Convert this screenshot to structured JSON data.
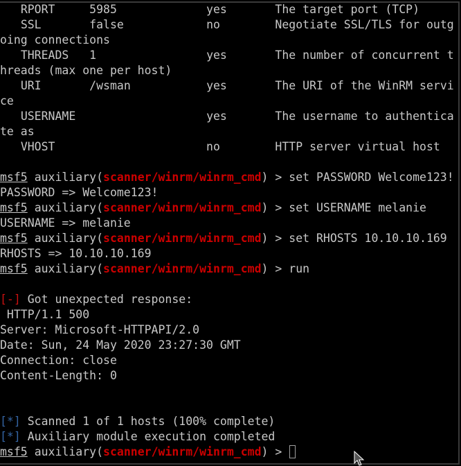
{
  "options_table": {
    "rows": [
      {
        "name": "RPORT",
        "setting": "5985",
        "required": "yes",
        "description": "The target port (TCP)",
        "wrap": null
      },
      {
        "name": "SSL",
        "setting": "false",
        "required": "no",
        "description": "Negotiate SSL/TLS for outg",
        "wrap": "oing connections"
      },
      {
        "name": "THREADS",
        "setting": "1",
        "required": "yes",
        "description": "The number of concurrent t",
        "wrap": "hreads (max one per host)"
      },
      {
        "name": "URI",
        "setting": "/wsman",
        "required": "yes",
        "description": "The URI of the WinRM servi",
        "wrap": "ce"
      },
      {
        "name": "USERNAME",
        "setting": "",
        "required": "yes",
        "description": "The username to authentica",
        "wrap": "te as"
      },
      {
        "name": "VHOST",
        "setting": "",
        "required": "no",
        "description": "HTTP server virtual host",
        "wrap": null
      }
    ]
  },
  "prompt": {
    "name": "msf5",
    "module_type": "auxiliary",
    "module_path": "scanner/winrm/winrm_cmd",
    "symbol": ">"
  },
  "session": [
    {
      "command": "set PASSWORD Welcome123!",
      "output": "PASSWORD => Welcome123!"
    },
    {
      "command": "set USERNAME melanie",
      "output": "USERNAME => melanie"
    },
    {
      "command": "set RHOSTS 10.10.10.169",
      "output": "RHOSTS => 10.10.10.169"
    },
    {
      "command": "run",
      "output": null
    }
  ],
  "run_output": {
    "error_marker": "[-]",
    "error_message": "Got unexpected response:",
    "response_lines": [
      " HTTP/1.1 500",
      "Server: Microsoft-HTTPAPI/2.0",
      "Date: Sun, 24 May 2020 23:27:30 GMT",
      "Connection: close",
      "Content-Length: 0"
    ],
    "status_marker": "[*]",
    "status_lines": [
      "Scanned 1 of 1 hosts (100% complete)",
      "Auxiliary module execution completed"
    ]
  },
  "current_input": "",
  "colors": {
    "background": "#000000",
    "text": "#c8c8c8",
    "module_path": "#cc0000",
    "error_marker": "#cc0000",
    "status_marker": "#3465a4"
  }
}
